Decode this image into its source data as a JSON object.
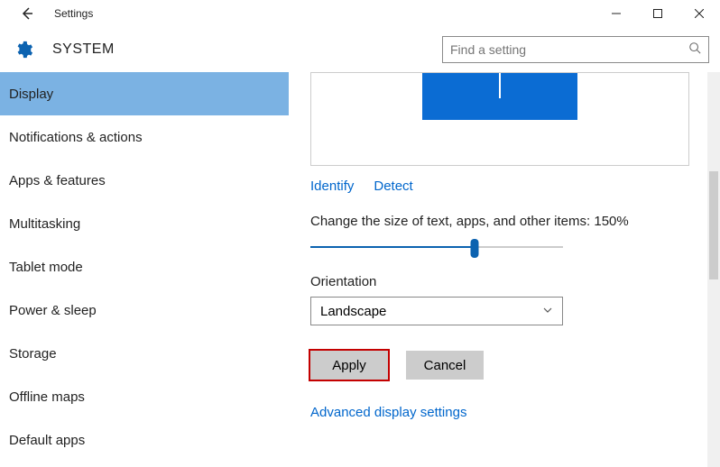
{
  "window": {
    "title": "Settings"
  },
  "header": {
    "title": "SYSTEM",
    "search_placeholder": "Find a setting"
  },
  "sidebar": {
    "items": [
      {
        "label": "Display",
        "selected": true
      },
      {
        "label": "Notifications & actions",
        "selected": false
      },
      {
        "label": "Apps & features",
        "selected": false
      },
      {
        "label": "Multitasking",
        "selected": false
      },
      {
        "label": "Tablet mode",
        "selected": false
      },
      {
        "label": "Power & sleep",
        "selected": false
      },
      {
        "label": "Storage",
        "selected": false
      },
      {
        "label": "Offline maps",
        "selected": false
      },
      {
        "label": "Default apps",
        "selected": false
      }
    ]
  },
  "main": {
    "identify": "Identify",
    "detect": "Detect",
    "scale_label": "Change the size of text, apps, and other items: 150%",
    "orientation_label": "Orientation",
    "orientation_value": "Landscape",
    "apply": "Apply",
    "cancel": "Cancel",
    "advanced": "Advanced display settings"
  }
}
